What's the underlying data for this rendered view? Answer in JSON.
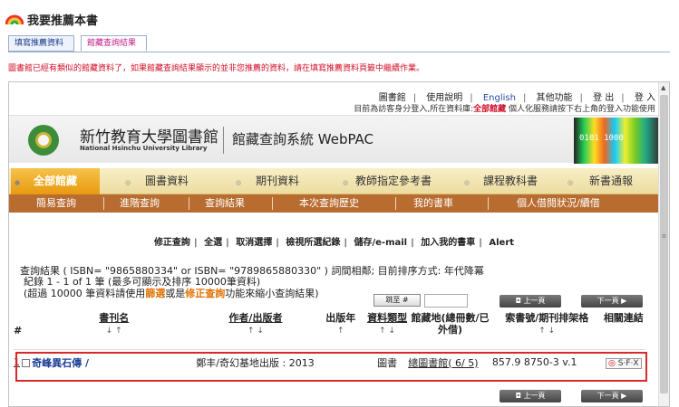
{
  "header": {
    "title": "我要推薦本書"
  },
  "tabs": [
    "填寫推薦資料",
    "館藏查詢結果"
  ],
  "notice": "圖書館已經有類似的館藏資料了，如果館藏查詢結果顯示的並非您推薦的資料，請在填寫推薦資料頁籤中繼續作業。",
  "toplinks": {
    "library": "圖書館",
    "help": "使用說明",
    "english": "English",
    "other": "其他功能",
    "logout": "登 出",
    "login": "登 入"
  },
  "topnote": {
    "prefix": "目前為訪客身分登入,所在資料庫:",
    "db": "全部館藏",
    "suffix": " 個人化服務請按下右上角的登入功能使用"
  },
  "brand": {
    "name_zh": "新竹教育大學圖書館",
    "name_en": "National Hsinchu University Library",
    "system": "館藏查詢系統 WebPAC",
    "binary": "0101 1000"
  },
  "mainnav": [
    "全部館藏",
    "圖書資料",
    "期刊資料",
    "教師指定參考書",
    "課程教科書",
    "新書通報"
  ],
  "subnav": [
    "簡易查詢",
    "進階查詢",
    "查詢結果",
    "本次查詢歷史",
    "我的書車",
    "個人借閱狀況/續借"
  ],
  "actions": [
    "修正查詢",
    "全選",
    "取消選擇",
    "檢視所選紀錄",
    "儲存/e-mail",
    "加入我的書車",
    "Alert"
  ],
  "query": "查詢結果 ( ISBN= \"9865880334\" or ISBN= \"9789865880330\" ) 詞間相鄰; 目前排序方式: 年代降冪",
  "records": {
    "line1": "紀錄 1 - 1 of 1 筆 (最多可顯示及排序 10000筆資料)",
    "line2a": "(超過 10000 筆資料請使用",
    "filter": "篩選",
    "line2b": "或是",
    "refine": "修正查詢",
    "line2c": "功能來縮小查詢結果)"
  },
  "jump": "跳至 #",
  "pager": {
    "prev": "上一頁",
    "next": "下一頁"
  },
  "table": {
    "headers": {
      "num": "#",
      "title": "書刊名",
      "author": "作者/出版者",
      "year": "出版年",
      "type": "資料類型",
      "location": "館藏地(總冊數/已外借)",
      "callno": "索書號/期刊排架格",
      "related": "相關連結"
    },
    "row": {
      "num": "1",
      "title": "奇峰異石傳 /",
      "author": "鄭丰/奇幻基地出版 : 2013",
      "type": "圖書",
      "location": "總圖書館( 6/ 5)",
      "callno": "857.9 8750-3 v.1",
      "sfx": "S·F·X"
    }
  }
}
